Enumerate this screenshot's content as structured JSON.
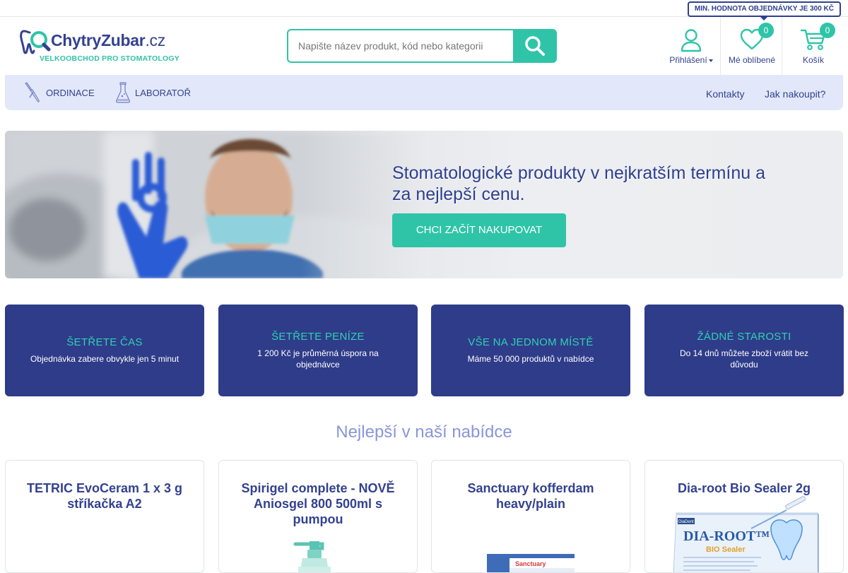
{
  "topbar": {
    "min_order": "MIN. HODNOTA OBJEDNÁVKY JE 300 KČ"
  },
  "logo": {
    "name": "ChytryZubar",
    "tld": ".cz",
    "tagline": "VELKOOBCHOD PRO STOMATOLOGY"
  },
  "search": {
    "placeholder": "Napište název produkt, kód nebo kategorii",
    "value": ""
  },
  "header": {
    "login_label": "Přihlášení",
    "favorites_label": "Mé oblíbené",
    "favorites_count": "0",
    "cart_label": "Košík",
    "cart_count": "0"
  },
  "nav": {
    "categories": [
      {
        "label": "ORDINACE",
        "icon": "dental-tool-icon"
      },
      {
        "label": "LABORATOŘ",
        "icon": "flask-icon"
      }
    ],
    "links": [
      {
        "label": "Kontakty"
      },
      {
        "label": "Jak nakoupit?"
      }
    ]
  },
  "hero": {
    "title": "Stomatologické produkty v nejkratším termínu a za nejlepší cenu.",
    "button": "CHCI ZAČÍT NAKUPOVAT"
  },
  "features": [
    {
      "title": "ŠETŘETE ČAS",
      "text": "Objednávka zabere obvykle jen 5 minut"
    },
    {
      "title": "ŠETŘETE PENÍZE",
      "text": "1 200 Kč je průměrná úspora na objednávce"
    },
    {
      "title": "VŠE NA JEDNOM MÍSTĚ",
      "text": "Máme 50 000 produktů v nabídce"
    },
    {
      "title": "ŽÁDNÉ STAROSTI",
      "text": "Do 14 dnů můžete zboží vrátit bez důvodu"
    }
  ],
  "section": {
    "title": "Nejlepší v naší nabídce"
  },
  "products": [
    {
      "name": "TETRIC EvoCeram 1 x 3 g stříkačka A2"
    },
    {
      "name": "Spirigel complete - NOVĚ Aniosgel 800 500ml s pumpou"
    },
    {
      "name": "Sanctuary kofferdam heavy/plain",
      "image_text": "Sanctuary"
    },
    {
      "name": "Dia-root Bio Sealer 2g",
      "image_text_brand": "DiaDent",
      "image_text_product": "DIA-ROOT™",
      "image_text_sub": "BIO Sealer"
    }
  ],
  "colors": {
    "brand_navy": "#33428f",
    "accent_teal": "#2fc4a7",
    "feature_bg": "#2f3c89",
    "nav_bg": "#e2e8fa"
  }
}
